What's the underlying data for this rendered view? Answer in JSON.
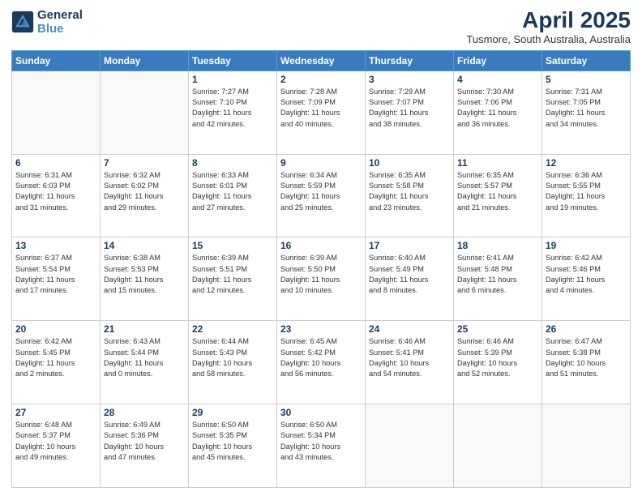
{
  "header": {
    "logo_line1": "General",
    "logo_line2": "Blue",
    "month_year": "April 2025",
    "location": "Tusmore, South Australia, Australia"
  },
  "weekdays": [
    "Sunday",
    "Monday",
    "Tuesday",
    "Wednesday",
    "Thursday",
    "Friday",
    "Saturday"
  ],
  "weeks": [
    [
      {
        "day": "",
        "info": ""
      },
      {
        "day": "",
        "info": ""
      },
      {
        "day": "1",
        "info": "Sunrise: 7:27 AM\nSunset: 7:10 PM\nDaylight: 11 hours\nand 42 minutes."
      },
      {
        "day": "2",
        "info": "Sunrise: 7:28 AM\nSunset: 7:09 PM\nDaylight: 11 hours\nand 40 minutes."
      },
      {
        "day": "3",
        "info": "Sunrise: 7:29 AM\nSunset: 7:07 PM\nDaylight: 11 hours\nand 38 minutes."
      },
      {
        "day": "4",
        "info": "Sunrise: 7:30 AM\nSunset: 7:06 PM\nDaylight: 11 hours\nand 36 minutes."
      },
      {
        "day": "5",
        "info": "Sunrise: 7:31 AM\nSunset: 7:05 PM\nDaylight: 11 hours\nand 34 minutes."
      }
    ],
    [
      {
        "day": "6",
        "info": "Sunrise: 6:31 AM\nSunset: 6:03 PM\nDaylight: 11 hours\nand 31 minutes."
      },
      {
        "day": "7",
        "info": "Sunrise: 6:32 AM\nSunset: 6:02 PM\nDaylight: 11 hours\nand 29 minutes."
      },
      {
        "day": "8",
        "info": "Sunrise: 6:33 AM\nSunset: 6:01 PM\nDaylight: 11 hours\nand 27 minutes."
      },
      {
        "day": "9",
        "info": "Sunrise: 6:34 AM\nSunset: 5:59 PM\nDaylight: 11 hours\nand 25 minutes."
      },
      {
        "day": "10",
        "info": "Sunrise: 6:35 AM\nSunset: 5:58 PM\nDaylight: 11 hours\nand 23 minutes."
      },
      {
        "day": "11",
        "info": "Sunrise: 6:35 AM\nSunset: 5:57 PM\nDaylight: 11 hours\nand 21 minutes."
      },
      {
        "day": "12",
        "info": "Sunrise: 6:36 AM\nSunset: 5:55 PM\nDaylight: 11 hours\nand 19 minutes."
      }
    ],
    [
      {
        "day": "13",
        "info": "Sunrise: 6:37 AM\nSunset: 5:54 PM\nDaylight: 11 hours\nand 17 minutes."
      },
      {
        "day": "14",
        "info": "Sunrise: 6:38 AM\nSunset: 5:53 PM\nDaylight: 11 hours\nand 15 minutes."
      },
      {
        "day": "15",
        "info": "Sunrise: 6:39 AM\nSunset: 5:51 PM\nDaylight: 11 hours\nand 12 minutes."
      },
      {
        "day": "16",
        "info": "Sunrise: 6:39 AM\nSunset: 5:50 PM\nDaylight: 11 hours\nand 10 minutes."
      },
      {
        "day": "17",
        "info": "Sunrise: 6:40 AM\nSunset: 5:49 PM\nDaylight: 11 hours\nand 8 minutes."
      },
      {
        "day": "18",
        "info": "Sunrise: 6:41 AM\nSunset: 5:48 PM\nDaylight: 11 hours\nand 6 minutes."
      },
      {
        "day": "19",
        "info": "Sunrise: 6:42 AM\nSunset: 5:46 PM\nDaylight: 11 hours\nand 4 minutes."
      }
    ],
    [
      {
        "day": "20",
        "info": "Sunrise: 6:42 AM\nSunset: 5:45 PM\nDaylight: 11 hours\nand 2 minutes."
      },
      {
        "day": "21",
        "info": "Sunrise: 6:43 AM\nSunset: 5:44 PM\nDaylight: 11 hours\nand 0 minutes."
      },
      {
        "day": "22",
        "info": "Sunrise: 6:44 AM\nSunset: 5:43 PM\nDaylight: 10 hours\nand 58 minutes."
      },
      {
        "day": "23",
        "info": "Sunrise: 6:45 AM\nSunset: 5:42 PM\nDaylight: 10 hours\nand 56 minutes."
      },
      {
        "day": "24",
        "info": "Sunrise: 6:46 AM\nSunset: 5:41 PM\nDaylight: 10 hours\nand 54 minutes."
      },
      {
        "day": "25",
        "info": "Sunrise: 6:46 AM\nSunset: 5:39 PM\nDaylight: 10 hours\nand 52 minutes."
      },
      {
        "day": "26",
        "info": "Sunrise: 6:47 AM\nSunset: 5:38 PM\nDaylight: 10 hours\nand 51 minutes."
      }
    ],
    [
      {
        "day": "27",
        "info": "Sunrise: 6:48 AM\nSunset: 5:37 PM\nDaylight: 10 hours\nand 49 minutes."
      },
      {
        "day": "28",
        "info": "Sunrise: 6:49 AM\nSunset: 5:36 PM\nDaylight: 10 hours\nand 47 minutes."
      },
      {
        "day": "29",
        "info": "Sunrise: 6:50 AM\nSunset: 5:35 PM\nDaylight: 10 hours\nand 45 minutes."
      },
      {
        "day": "30",
        "info": "Sunrise: 6:50 AM\nSunset: 5:34 PM\nDaylight: 10 hours\nand 43 minutes."
      },
      {
        "day": "",
        "info": ""
      },
      {
        "day": "",
        "info": ""
      },
      {
        "day": "",
        "info": ""
      }
    ]
  ]
}
